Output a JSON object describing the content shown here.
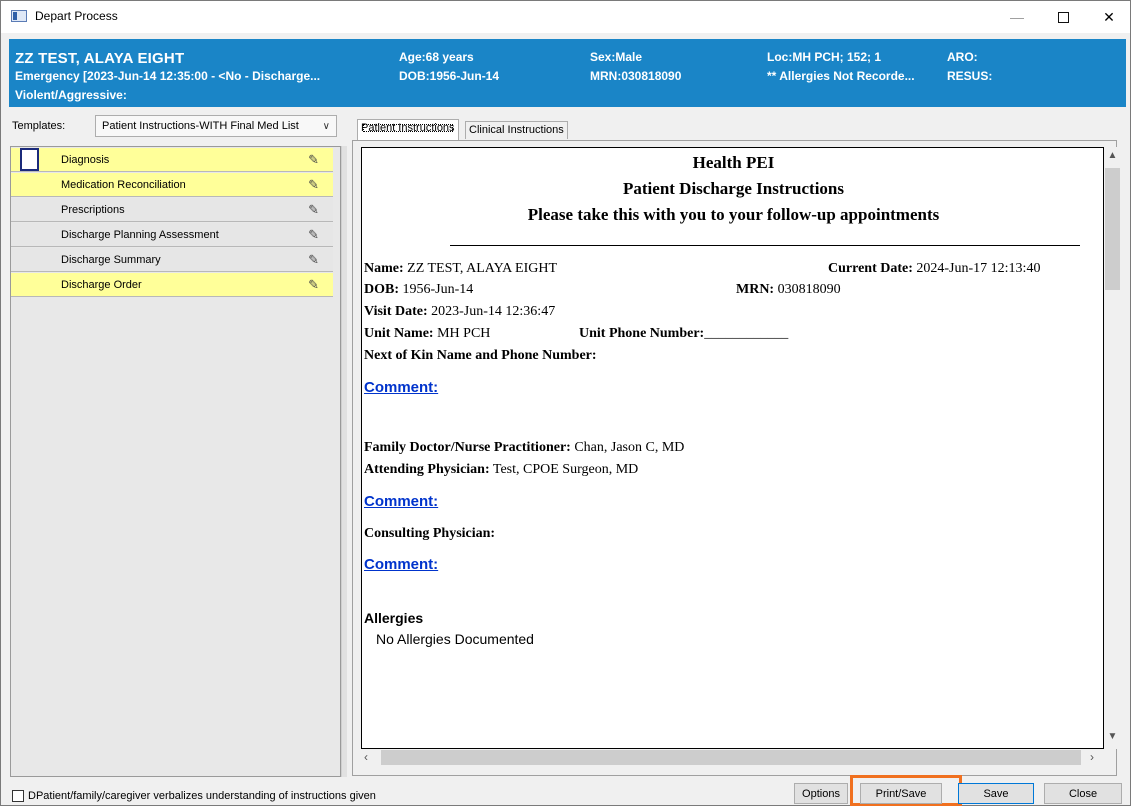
{
  "window": {
    "title": "Depart Process",
    "minimize": "—",
    "close": "✕"
  },
  "banner": {
    "name": "ZZ TEST, ALAYA EIGHT",
    "encounter": "Emergency [2023-Jun-14 12:35:00 - <No - Discharge...",
    "violent": "Violent/Aggressive:",
    "age": "Age:68 years",
    "dob": "DOB:1956-Jun-14",
    "sex": "Sex:Male",
    "mrn": "MRN:030818090",
    "loc": "Loc:MH PCH; 152; 1",
    "allergies": "** Allergies Not Recorde...",
    "aro": "ARO:",
    "resus": "RESUS:"
  },
  "templates": {
    "label": "Templates:",
    "selected": "Patient Instructions-WITH Final Med List"
  },
  "sections": [
    {
      "label": "Diagnosis",
      "color": "#ffff99"
    },
    {
      "label": "Medication Reconciliation",
      "color": "#ffff99"
    },
    {
      "label": "Prescriptions",
      "color": "#e6e6e6"
    },
    {
      "label": "Discharge Planning Assessment",
      "color": "#e6e6e6"
    },
    {
      "label": "Discharge Summary",
      "color": "#e6e6e6"
    },
    {
      "label": "Discharge Order",
      "color": "#ffff99"
    }
  ],
  "tabs": [
    "Patient Instructions",
    "Clinical Instructions"
  ],
  "document": {
    "header1": "Health PEI",
    "header2": "Patient Discharge Instructions",
    "header3": "Please take this with you to your follow-up appointments",
    "name_label": "Name:",
    "name_value": "ZZ TEST, ALAYA EIGHT",
    "current_date_label": "Current Date:",
    "current_date_value": "2024-Jun-17 12:13:40",
    "dob_label": "DOB:",
    "dob_value": "1956-Jun-14",
    "mrn_label": "MRN:",
    "mrn_value": "030818090",
    "visit_label": "Visit Date:",
    "visit_value": "2023-Jun-14 12:36:47",
    "unit_label": "Unit Name:",
    "unit_value": "MH PCH",
    "unit_phone_label": "Unit Phone Number:",
    "unit_phone_blank": "____________",
    "kin_label": "Next of Kin Name and Phone Number:",
    "comment": "Comment:",
    "family_label": "Family Doctor/Nurse Practitioner:",
    "family_value": "Chan, Jason C, MD",
    "attending_label": "Attending  Physician:",
    "attending_value": "Test, CPOE Surgeon, MD",
    "consulting_label": "Consulting Physician:",
    "allergies_heading": "Allergies",
    "allergies_value": "No Allergies Documented"
  },
  "footer": {
    "checkbox_label": "DPatient/family/caregiver verbalizes understanding of instructions given",
    "options": "Options",
    "print_save": "Print/Save",
    "save": "Save",
    "close": "Close"
  },
  "colors": {
    "banner": "#1a85c7",
    "highlight": "#f0701f",
    "link": "#0033cc"
  }
}
